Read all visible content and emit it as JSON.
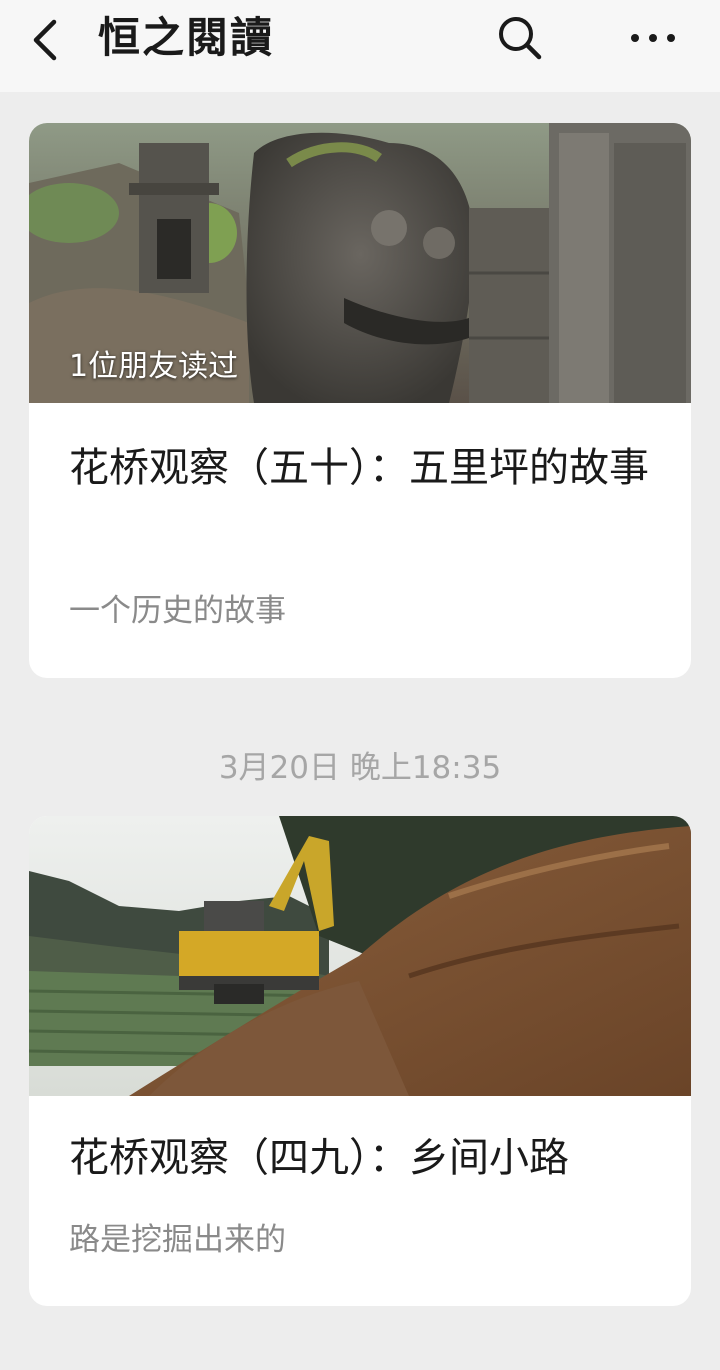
{
  "header": {
    "title": "恒之閱讀",
    "back_icon": "chevron-left-icon",
    "search_icon": "search-icon",
    "more_icon": "more-horizontal-icon"
  },
  "articles": [
    {
      "cover_image": "stone-lion-sculpture-photo",
      "friends_read": "1位朋友读过",
      "title": "花桥观察（五十）：五里坪的故事",
      "digest": "一个历史的故事"
    },
    {
      "cover_image": "excavator-dirt-road-photo",
      "title": "花桥观察（四九）：乡间小路",
      "digest": "路是挖掘出来的"
    }
  ],
  "timestamp": "3月20日 晚上18:35",
  "colors": {
    "background": "#ededed",
    "card": "#ffffff",
    "title_text": "#1a1a1a",
    "digest_text": "#8a8a8a",
    "timestamp_text": "#a6a6a6"
  }
}
